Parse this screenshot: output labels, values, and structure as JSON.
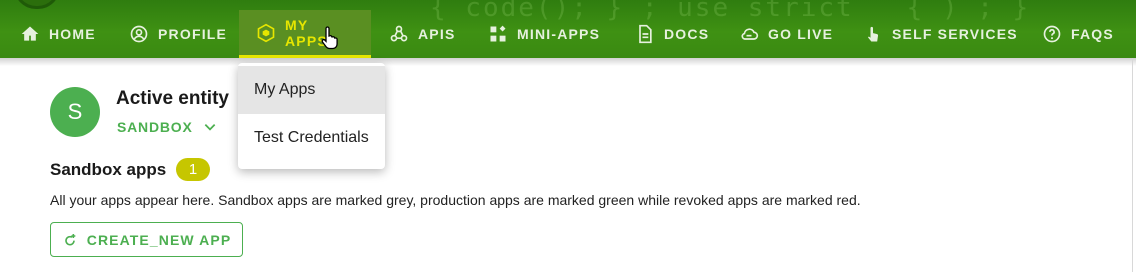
{
  "nav": {
    "items": [
      {
        "label": "HOME",
        "icon": "home-icon"
      },
      {
        "label": "PROFILE",
        "icon": "profile-icon"
      },
      {
        "label": "MY APPS",
        "icon": "cube-icon",
        "active": true
      },
      {
        "label": "APIS",
        "icon": "webhook-icon"
      },
      {
        "label": "MINI-APPS",
        "icon": "widgets-icon"
      },
      {
        "label": "DOCS",
        "icon": "document-icon"
      },
      {
        "label": "GO LIVE",
        "icon": "cloud-icon"
      },
      {
        "label": "SELF SERVICES",
        "icon": "touch-icon"
      },
      {
        "label": "FAQS",
        "icon": "help-icon"
      }
    ],
    "colors": {
      "bar": "#3a8a12",
      "active_text": "#e6e600",
      "text": "#e6f1de"
    }
  },
  "dropdown": {
    "items": [
      "My Apps",
      "Test Credentials"
    ],
    "selected": "My Apps"
  },
  "entity": {
    "avatar_letter": "S",
    "title": "Active entity",
    "selected": "SANDBOX"
  },
  "apps_section": {
    "title": "Sandbox apps",
    "count": "1",
    "description": "All your apps appear here. Sandbox apps are marked grey, production apps are marked green while revoked apps are marked red.",
    "create_button": "CREATE_NEW APP"
  },
  "colors": {
    "accent": "#4caf50",
    "badge": "#c6c600"
  }
}
